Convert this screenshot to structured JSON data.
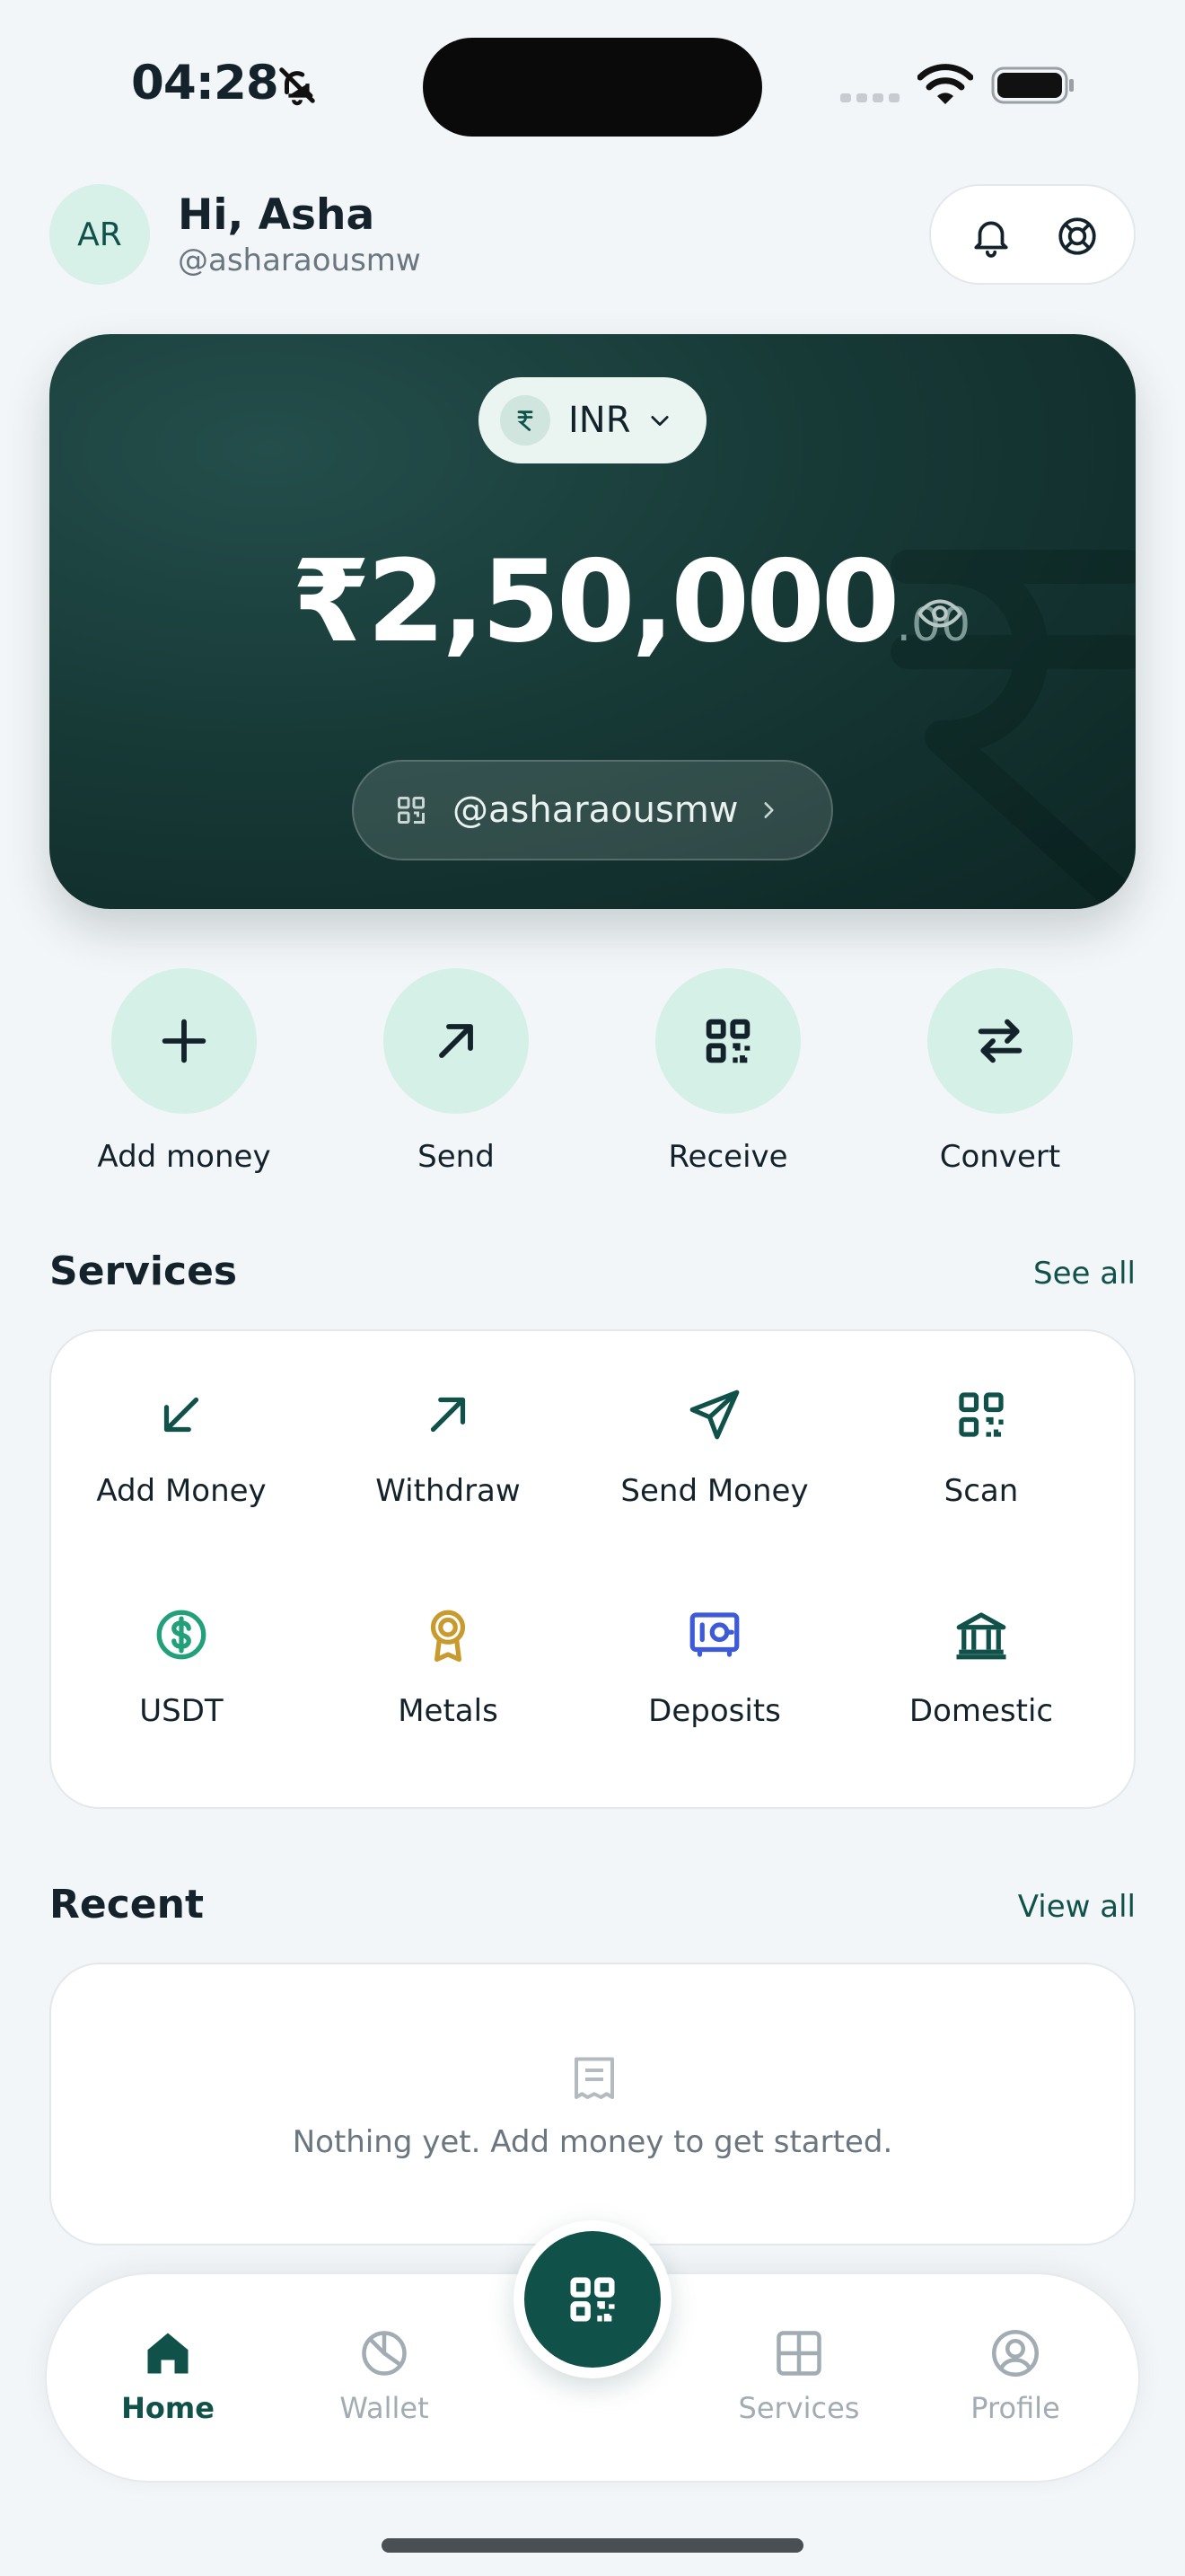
{
  "status_bar": {
    "time": "04:28"
  },
  "header": {
    "avatar_initials": "AR",
    "greeting": "Hi, Asha",
    "handle": "@asharaousmw",
    "icons": [
      "bell-icon",
      "support-lifebuoy-icon"
    ]
  },
  "balance_card": {
    "currency": "INR",
    "currency_symbol_icon": "rupee-icon",
    "amount_main": "₹2,50,000",
    "amount_decimal": ".00",
    "visibility_icon": "eye-icon",
    "handle": "@asharaousmw"
  },
  "quick_actions": [
    {
      "label": "Add money",
      "icon": "plus-icon"
    },
    {
      "label": "Send",
      "icon": "arrow-up-right-icon"
    },
    {
      "label": "Receive",
      "icon": "qr-code-icon"
    },
    {
      "label": "Convert",
      "icon": "swap-arrows-icon"
    }
  ],
  "services": {
    "title": "Services",
    "link": "See all",
    "items": [
      {
        "label": "Add Money",
        "icon": "arrow-down-left-icon"
      },
      {
        "label": "Withdraw",
        "icon": "arrow-up-right-icon"
      },
      {
        "label": "Send Money",
        "icon": "paper-plane-icon"
      },
      {
        "label": "Scan",
        "icon": "qr-scan-icon"
      },
      {
        "label": "USDT",
        "icon": "dollar-coin-icon"
      },
      {
        "label": "Metals",
        "icon": "medal-icon"
      },
      {
        "label": "Deposits",
        "icon": "safe-icon"
      },
      {
        "label": "Domestic",
        "icon": "bank-icon"
      }
    ]
  },
  "recent": {
    "title": "Recent",
    "link": "View all",
    "empty_message": "Nothing yet. Add money to get started."
  },
  "bottom_nav": {
    "items": [
      {
        "label": "Home",
        "icon": "home-icon",
        "active": true
      },
      {
        "label": "Wallet",
        "icon": "pie-chart-icon",
        "active": false
      },
      {
        "label": "Services",
        "icon": "grid-icon",
        "active": false
      },
      {
        "label": "Profile",
        "icon": "user-circle-icon",
        "active": false
      }
    ],
    "center_button_icon": "qr-scan-icon"
  },
  "colors": {
    "accent": "#10514A",
    "card_bg": "#173A37",
    "action_circle": "#D5F0E6",
    "page_bg": "#F3F6F8"
  }
}
